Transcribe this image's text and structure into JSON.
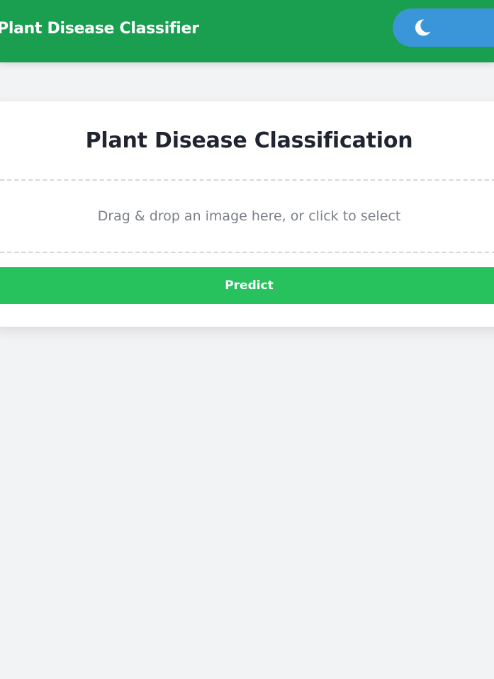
{
  "app": {
    "title": "Plant Disease Classifier",
    "accent_color": "#1a9e4f",
    "toggle_color": "#3a96d8"
  },
  "theme_toggle": {
    "icon": "moon-icon"
  },
  "card": {
    "title": "Plant Disease Classification"
  },
  "dropzone": {
    "instruction": "Drag & drop an image here, or click to select"
  },
  "predict": {
    "label": "Predict",
    "color": "#27c25e"
  }
}
